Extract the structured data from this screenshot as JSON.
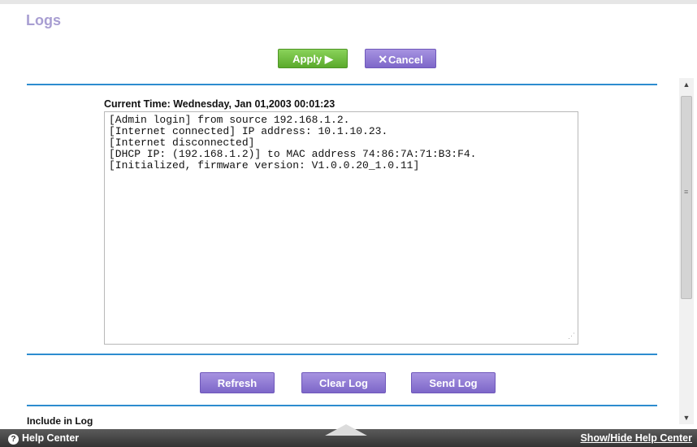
{
  "page": {
    "title": "Logs"
  },
  "toolbar": {
    "apply_label": "Apply ▶",
    "cancel_label": "Cancel",
    "cancel_icon": "x-icon"
  },
  "log": {
    "current_time": "Current Time: Wednesday, Jan 01,2003 00:01:23",
    "lines": [
      "[Admin login] from source 192.168.1.2.",
      "[Internet connected] IP address: 10.1.10.23.",
      "[Internet disconnected]",
      "[DHCP IP: (192.168.1.2)] to MAC address 74:86:7A:71:B3:F4.",
      "[Initialized, firmware version: V1.0.0.20_1.0.11]"
    ]
  },
  "actions": {
    "refresh_label": "Refresh",
    "clear_label": "Clear Log",
    "send_label": "Send Log"
  },
  "include": {
    "label": "Include in Log"
  },
  "help": {
    "help_center": "Help Center",
    "show_hide": "Show/Hide Help Center"
  },
  "colors": {
    "accent_blue": "#2d8ccf",
    "apply_green": "#5aa92b",
    "button_purple": "#7d67c9",
    "title_purple": "#a89ed2"
  }
}
